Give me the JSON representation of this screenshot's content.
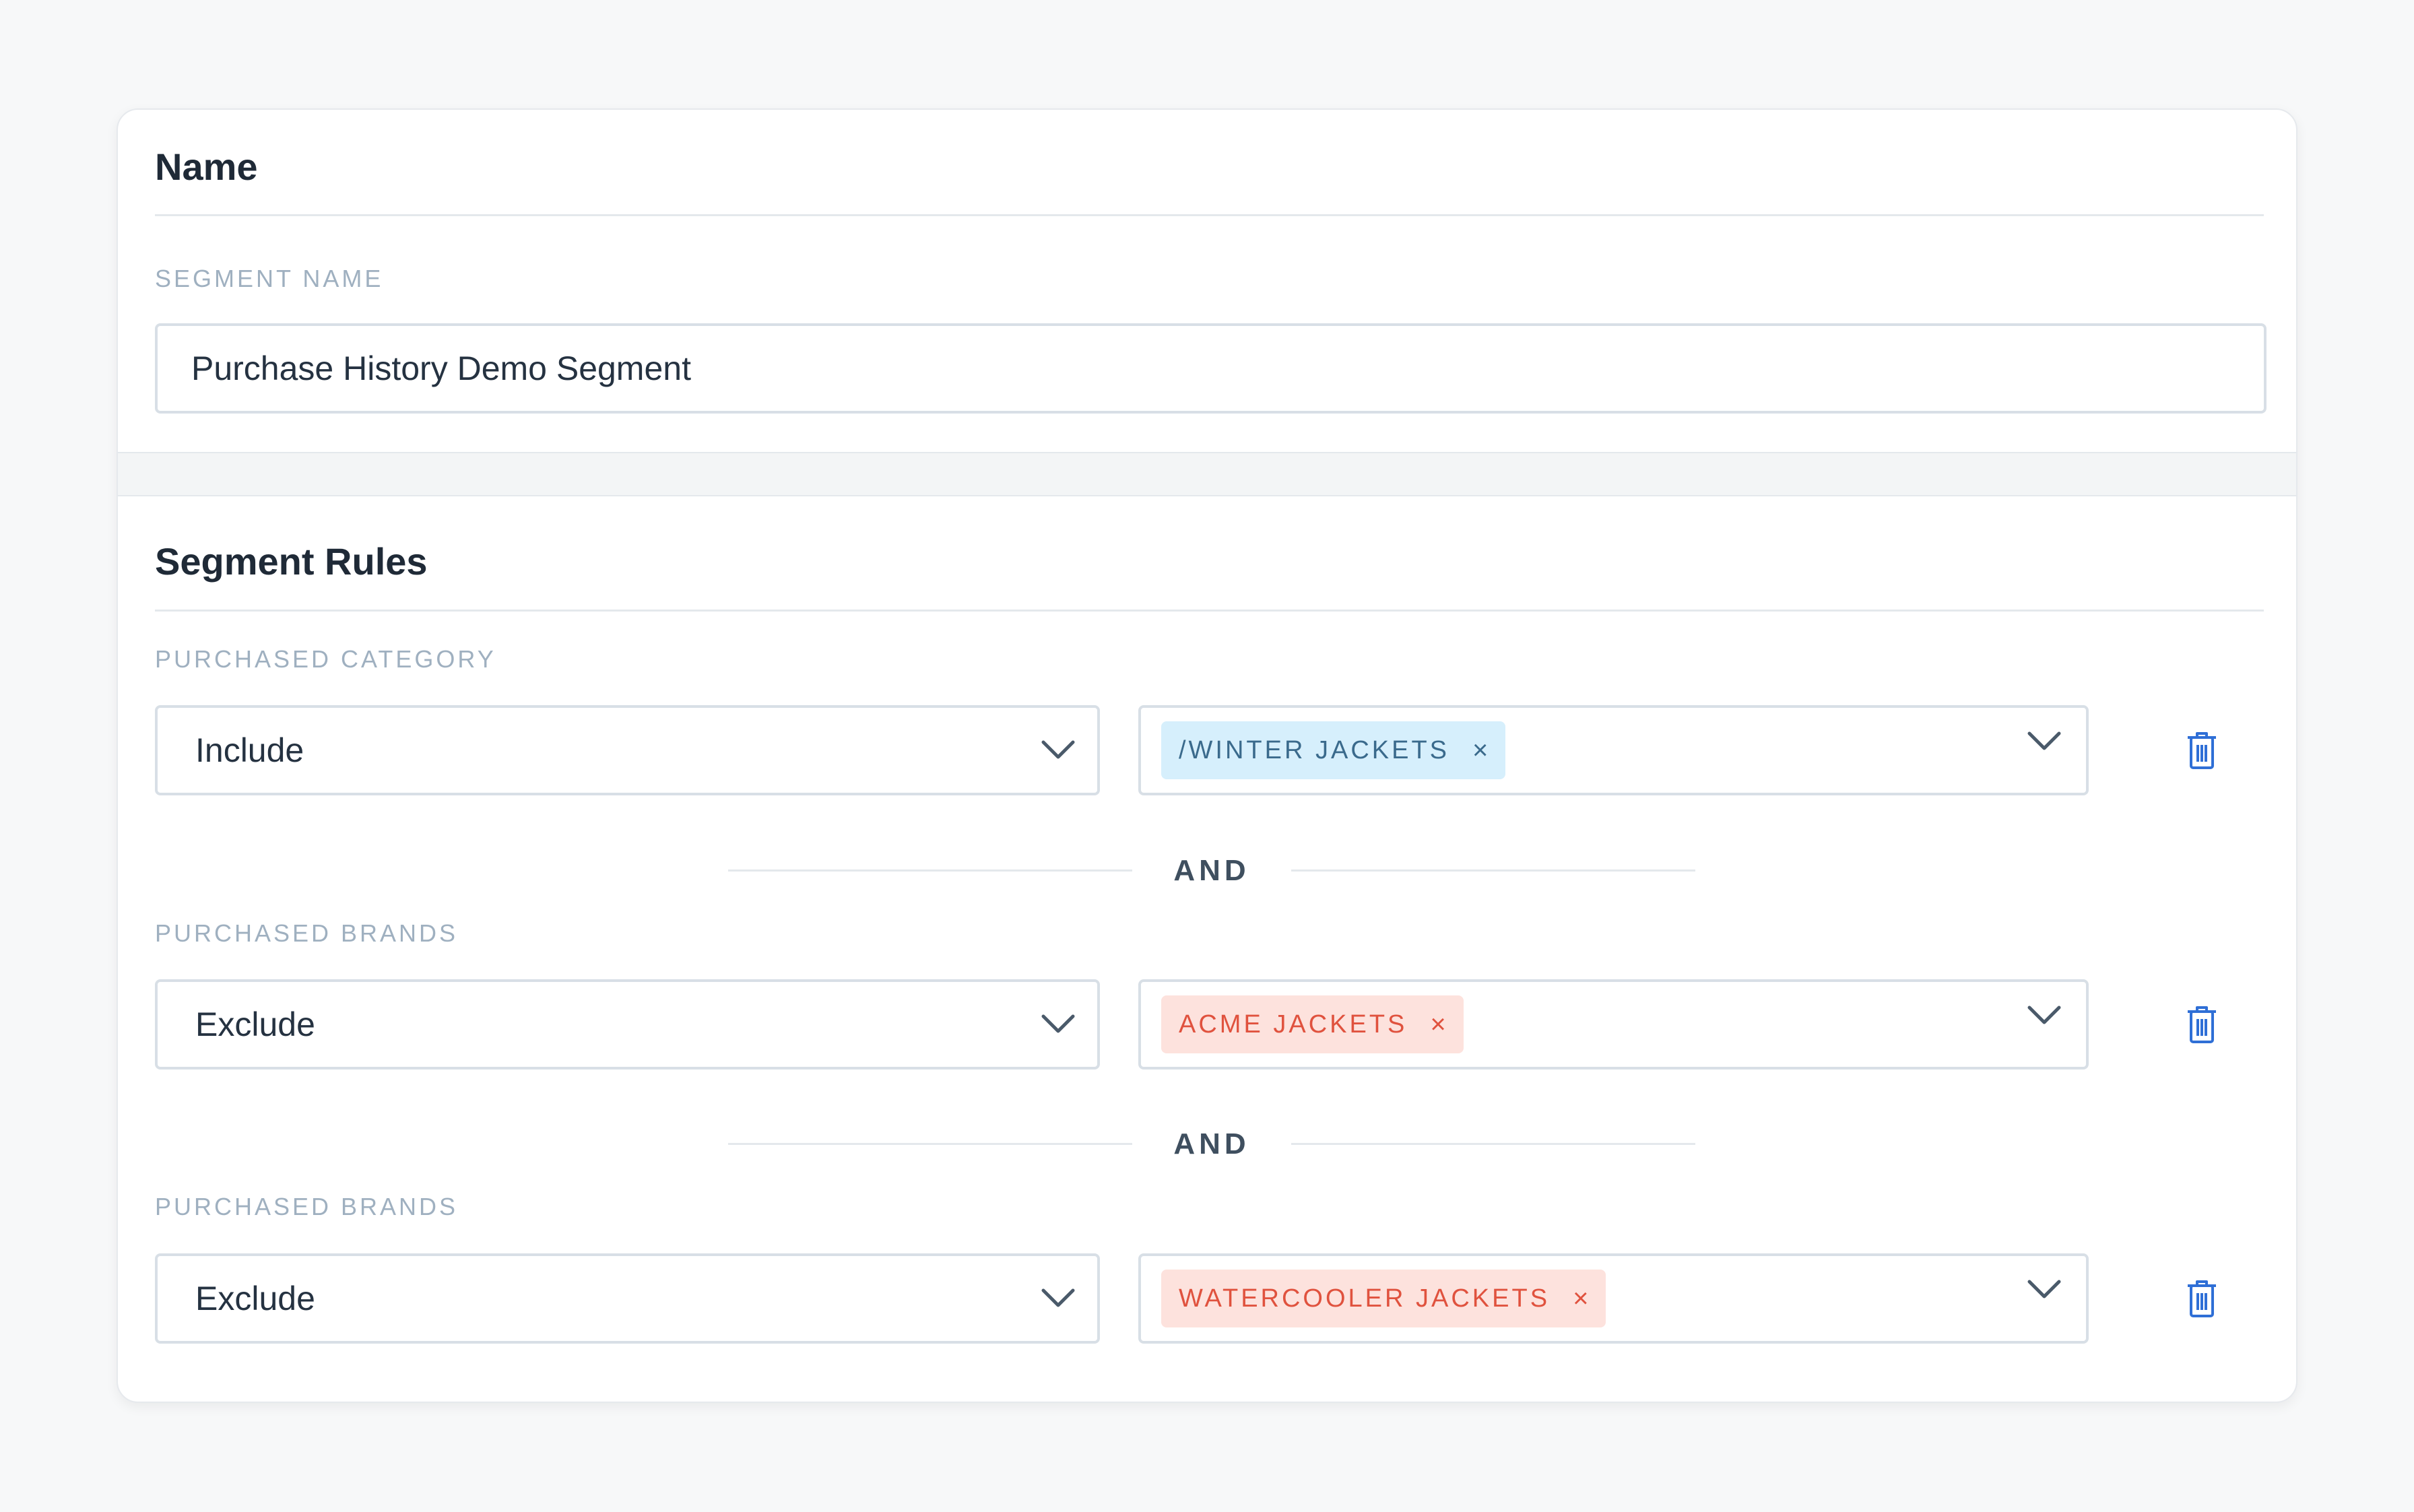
{
  "name_section": {
    "title": "Name",
    "segment_name_label": "SEGMENT NAME",
    "segment_name_value": "Purchase History Demo Segment"
  },
  "rules_section": {
    "title": "Segment Rules",
    "rules": [
      {
        "label": "PURCHASED CATEGORY",
        "mode": "Include",
        "tag": "/WINTER JACKETS",
        "tag_color": "#d6effc"
      },
      {
        "label": "PURCHASED BRANDS",
        "mode": "Exclude",
        "tag": "ACME JACKETS",
        "tag_color": "#fde2dd"
      },
      {
        "label": "PURCHASED BRANDS",
        "mode": "Exclude",
        "tag": "WATERCOOLER JACKETS",
        "tag_color": "#fde2dd"
      }
    ],
    "connectors": [
      "AND",
      "AND"
    ],
    "tag_remove_symbol": "×"
  },
  "colors": {
    "accent_blue": "#2f6fd6",
    "include_tag_text": "#3a6a8c",
    "exclude_tag_text": "#e0523e"
  }
}
